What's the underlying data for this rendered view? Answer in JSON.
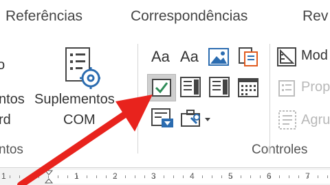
{
  "tabs": [
    {
      "label": "Referências"
    },
    {
      "label": "Correspondências"
    },
    {
      "label": "Rev"
    }
  ],
  "left_fragment": {
    "top": "o",
    "line1": "ntos",
    "line2": "rd",
    "group": "ntos"
  },
  "com_addins": {
    "line1": "Suplementos",
    "line2": "COM"
  },
  "controls": {
    "group_label": "Controles",
    "aa_rich": "Aa",
    "aa_plain": "Aa"
  },
  "right_panel": {
    "mode_label": "Mod",
    "properties_label": "Prop",
    "group_label": "Agru"
  },
  "ruler": {
    "numbers": [
      "1",
      "1",
      "2",
      "3",
      "4",
      "5",
      "6",
      "7"
    ]
  },
  "colors": {
    "checkbox_green": "#2e8b57",
    "accent_blue": "#2b6cb0",
    "arrow_red": "#e8231d"
  }
}
